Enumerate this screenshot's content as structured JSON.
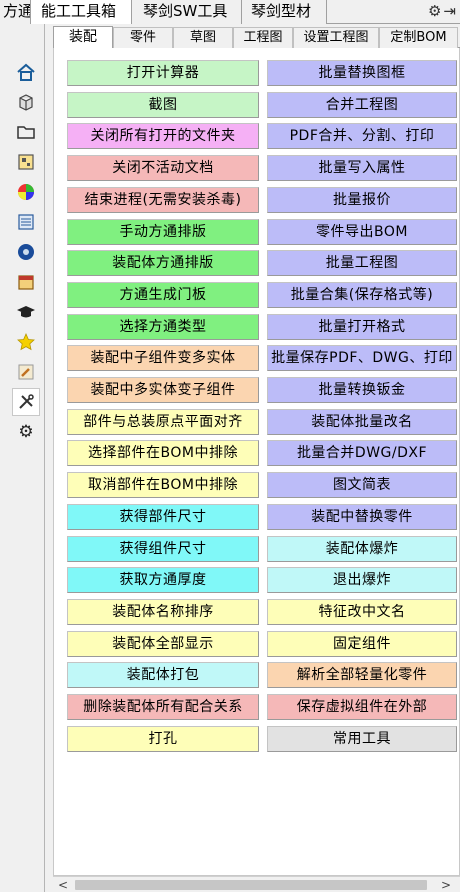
{
  "top_tabs": [
    "方通",
    "能工工具箱",
    "琴剑SW工具",
    "琴剑型材"
  ],
  "top_icons": [
    "gear-icon",
    "pin-icon"
  ],
  "side_icons": [
    "home-icon",
    "cube-icon",
    "folder-icon",
    "grid-icon",
    "color-wheel-icon",
    "list-icon",
    "disc-icon",
    "calendar-icon",
    "graduation-cap-icon",
    "star-icon",
    "pencil-icon",
    "tools-icon",
    "settings-icon"
  ],
  "sub_tabs": [
    "装配",
    "零件",
    "草图",
    "工程图",
    "设置工程图",
    "定制BOM"
  ],
  "buttons_left": [
    {
      "label": "打开计算器",
      "color": "#c6f5c6"
    },
    {
      "label": "截图",
      "color": "#c6f5c6"
    },
    {
      "label": "关闭所有打开的文件夹",
      "color": "#f5b0f5"
    },
    {
      "label": "关闭不活动文档",
      "color": "#f5b8b8"
    },
    {
      "label": "结束进程(无需安装杀毒)",
      "color": "#f5b8b8"
    },
    {
      "label": "手动方通排版",
      "color": "#80f080"
    },
    {
      "label": "装配体方通排版",
      "color": "#80f080"
    },
    {
      "label": "方通生成门板",
      "color": "#80f080"
    },
    {
      "label": "选择方通类型",
      "color": "#80f080"
    },
    {
      "label": "装配中子组件变多实体",
      "color": "#fbd5b0"
    },
    {
      "label": "装配中多实体变子组件",
      "color": "#fbd5b0"
    },
    {
      "label": "部件与总装原点平面对齐",
      "color": "#fefeb8"
    },
    {
      "label": "选择部件在BOM中排除",
      "color": "#fefeb8"
    },
    {
      "label": "取消部件在BOM中排除",
      "color": "#fefeb8"
    },
    {
      "label": "获得部件尺寸",
      "color": "#80f8f8"
    },
    {
      "label": "获得组件尺寸",
      "color": "#80f8f8"
    },
    {
      "label": "获取方通厚度",
      "color": "#80f8f8"
    },
    {
      "label": "装配体名称排序",
      "color": "#fefeb8"
    },
    {
      "label": "装配体全部显示",
      "color": "#fefeb8"
    },
    {
      "label": "装配体打包",
      "color": "#c0f8f8"
    },
    {
      "label": "删除装配体所有配合关系",
      "color": "#f5b8b8"
    },
    {
      "label": "打孔",
      "color": "#fefeb8"
    }
  ],
  "buttons_right": [
    {
      "label": "批量替换图框",
      "color": "#bcbcf8"
    },
    {
      "label": "合并工程图",
      "color": "#bcbcf8"
    },
    {
      "label": "PDF合并、分割、打印",
      "color": "#bcbcf8"
    },
    {
      "label": "批量写入属性",
      "color": "#bcbcf8"
    },
    {
      "label": "批量报价",
      "color": "#bcbcf8"
    },
    {
      "label": "零件导出BOM",
      "color": "#bcbcf8"
    },
    {
      "label": "批量工程图",
      "color": "#bcbcf8"
    },
    {
      "label": "批量合集(保存格式等)",
      "color": "#bcbcf8"
    },
    {
      "label": "批量打开格式",
      "color": "#bcbcf8"
    },
    {
      "label": "批量保存PDF、DWG、打印",
      "color": "#bcbcf8"
    },
    {
      "label": "批量转换钣金",
      "color": "#bcbcf8"
    },
    {
      "label": "装配体批量改名",
      "color": "#bcbcf8"
    },
    {
      "label": "批量合并DWG/DXF",
      "color": "#bcbcf8"
    },
    {
      "label": "图文简表",
      "color": "#bcbcf8"
    },
    {
      "label": "装配中替换零件",
      "color": "#bcbcf8"
    },
    {
      "label": "装配体爆炸",
      "color": "#c0f8f8"
    },
    {
      "label": "退出爆炸",
      "color": "#c0f8f8"
    },
    {
      "label": "特征改中文名",
      "color": "#fefeb8"
    },
    {
      "label": "固定组件",
      "color": "#fefeb8"
    },
    {
      "label": "解析全部轻量化零件",
      "color": "#fbd5b0"
    },
    {
      "label": "保存虚拟组件在外部",
      "color": "#f5b8b8"
    },
    {
      "label": "常用工具",
      "color": "#e2e2e2"
    }
  ],
  "scroll_arrows": {
    "left": "<",
    "right": ">"
  }
}
